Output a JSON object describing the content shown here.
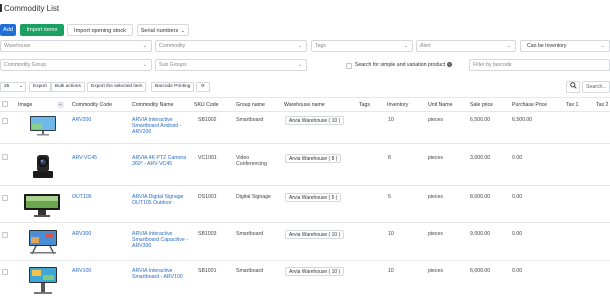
{
  "page": {
    "title": "Commodity List"
  },
  "toolbar": {
    "add": "Add",
    "import_items": "Import items",
    "import_opening_stock": "Import opening stock",
    "serial_numbers": "Serial numbers"
  },
  "filters": {
    "warehouse": "Warehouse",
    "commodity": "Commodity",
    "tags": "Tags",
    "alert": "Alert",
    "inventory": "Can be Inventory",
    "commodity_group": "Commodity Group",
    "sub_groups": "Sub Groups",
    "search_label": "Search for simple and variation product",
    "barcode_placeholder": "Filter by barcode"
  },
  "table_controls": {
    "page_size": "25",
    "export": "Export",
    "bulk_actions": "Bulk actions",
    "export_selected": "Export the selected item",
    "barcode_printing": "Barcode Printing",
    "search_placeholder": "Search..."
  },
  "columns": [
    "Image",
    "Commodity Code",
    "Commodity Name",
    "SKU Code",
    "Group name",
    "Warehouse name",
    "Tags",
    "Inventory",
    "Unit Name",
    "Sale price",
    "Purchase Price",
    "Tax 1",
    "Tax 2"
  ],
  "rows": [
    {
      "code": "ARV200",
      "name": "ARVIA Interactive Smartboard Android - ARV200",
      "sku": "SB1002",
      "group": "Smartboard",
      "warehouse": "Arvia Warehouse ( 10 )",
      "inventory": "10",
      "unit": "pieces",
      "sale": "6,500.00",
      "purchase": "6,500.00"
    },
    {
      "code": "ARV-VC45",
      "name": "ARVIA 4K PTZ Camera 360° - ARV-VC45",
      "sku": "VC1001",
      "group": "Video Conferencing",
      "warehouse": "Arvia Warehouse ( 8 )",
      "inventory": "8",
      "unit": "pieces",
      "sale": "3,000.00",
      "purchase": "0.00"
    },
    {
      "code": "OUT105",
      "name": "ARVIA Digital Signage OUT105 Outdoor",
      "sku": "DS1001",
      "group": "Digital Signage",
      "warehouse": "Arvia Warehouse ( 5 )",
      "inventory": "5",
      "unit": "pieces",
      "sale": "8,000.00",
      "purchase": "0.00"
    },
    {
      "code": "ARV300",
      "name": "ARVIA Interactive Smartboard Capacitive - ARV300",
      "sku": "SB1003",
      "group": "Smartboard",
      "warehouse": "Arvia Warehouse ( 10 )",
      "inventory": "10",
      "unit": "pieces",
      "sale": "9,000.00",
      "purchase": "0.00"
    },
    {
      "code": "ARV100",
      "name": "ARVIA Interactive Smartboard - ARV100",
      "sku": "SB1001",
      "group": "Smartboard",
      "warehouse": "Arvia Warehouse ( 10 )",
      "inventory": "10",
      "unit": "pieces",
      "sale": "6,000.00",
      "purchase": "0.00"
    }
  ],
  "icons": {
    "title": "list-icon",
    "chevron": "chevron-down-icon",
    "search": "search-icon",
    "refresh": "refresh-icon",
    "info": "info-icon"
  },
  "colors": {
    "primary": "#1f6fd6",
    "success": "#1aa061",
    "link": "#2b6cc9"
  }
}
